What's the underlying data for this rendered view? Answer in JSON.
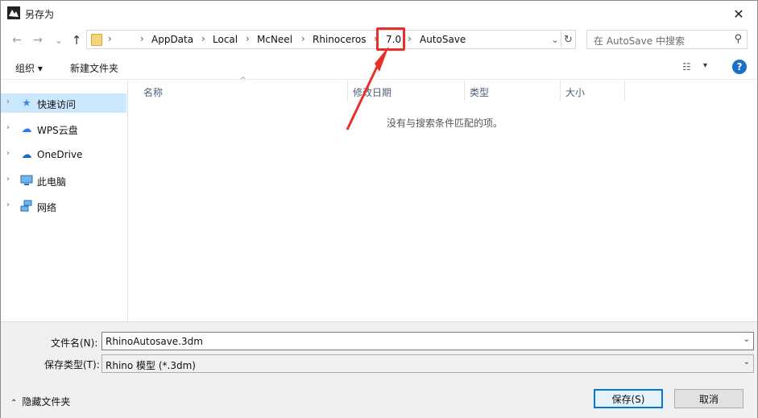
{
  "window": {
    "title": "另存为",
    "close_glyph": "✕"
  },
  "nav": {
    "back_glyph": "←",
    "forward_glyph": "→",
    "recent_glyph": "⌄",
    "up_glyph": "↑"
  },
  "address": {
    "lead_sep": "›",
    "crumbs": [
      "AppData",
      "Local",
      "McNeel",
      "Rhinoceros",
      "7.0",
      "AutoSave"
    ],
    "sep": "›",
    "dropdown_glyph": "⌄",
    "refresh_glyph": "↻"
  },
  "search": {
    "placeholder": "在 AutoSave 中搜索",
    "icon_glyph": "⚲"
  },
  "toolbar": {
    "organize_label": "组织 ▾",
    "new_folder_label": "新建文件夹",
    "view_glyph": "☷",
    "view_arrow": "▾",
    "help_glyph": "?"
  },
  "sidebar": {
    "items": [
      {
        "label": "快速访问",
        "icon": "star-icon",
        "selected": true
      },
      {
        "label": "WPS云盘",
        "icon": "cloud-icon",
        "selected": false
      },
      {
        "label": "OneDrive",
        "icon": "onedrive-icon",
        "selected": false
      },
      {
        "label": "此电脑",
        "icon": "computer-icon",
        "selected": false
      },
      {
        "label": "网络",
        "icon": "network-icon",
        "selected": false
      }
    ]
  },
  "filelist": {
    "columns": [
      "名称",
      "修改日期",
      "类型",
      "大小"
    ],
    "empty_message": "没有与搜索条件匹配的项。"
  },
  "form": {
    "filename_label": "文件名(N):",
    "filename_value": "RhinoAutosave.3dm",
    "filetype_label": "保存类型(T):",
    "filetype_value": "Rhino 模型 (*.3dm)",
    "hide_folders_label": "隐藏文件夹",
    "save_label": "保存(S)",
    "cancel_label": "取消"
  },
  "colors": {
    "highlight": "#e8302b",
    "selection": "#cce8ff",
    "accent": "#0078d7"
  }
}
